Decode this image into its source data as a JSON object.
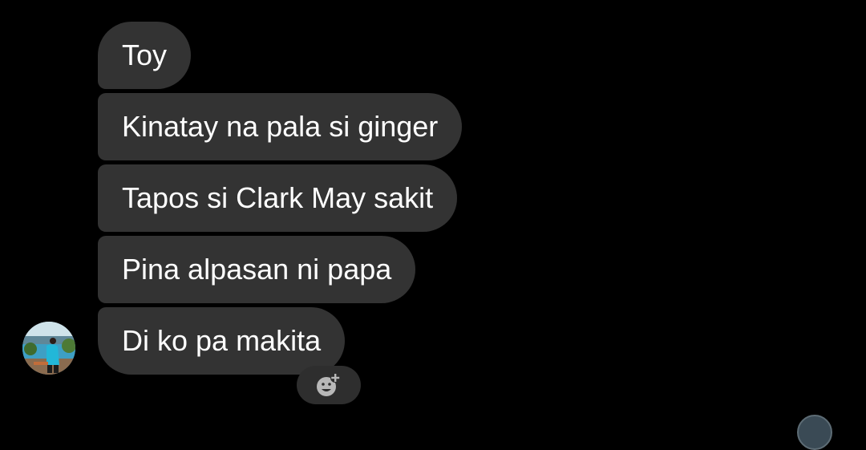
{
  "conversation": {
    "messages": [
      {
        "text": "Toy"
      },
      {
        "text": "Kinatay na pala si ginger"
      },
      {
        "text": "Tapos si Clark May sakit"
      },
      {
        "text": "Pina alpasan ni papa"
      },
      {
        "text": "Di ko pa makita"
      }
    ]
  },
  "icons": {
    "avatar": "contact-avatar",
    "reaction": "add-reaction-icon"
  },
  "colors": {
    "background": "#000000",
    "bubble": "#333333",
    "text": "#ffffff",
    "reaction_button": "#2e2e2e"
  }
}
